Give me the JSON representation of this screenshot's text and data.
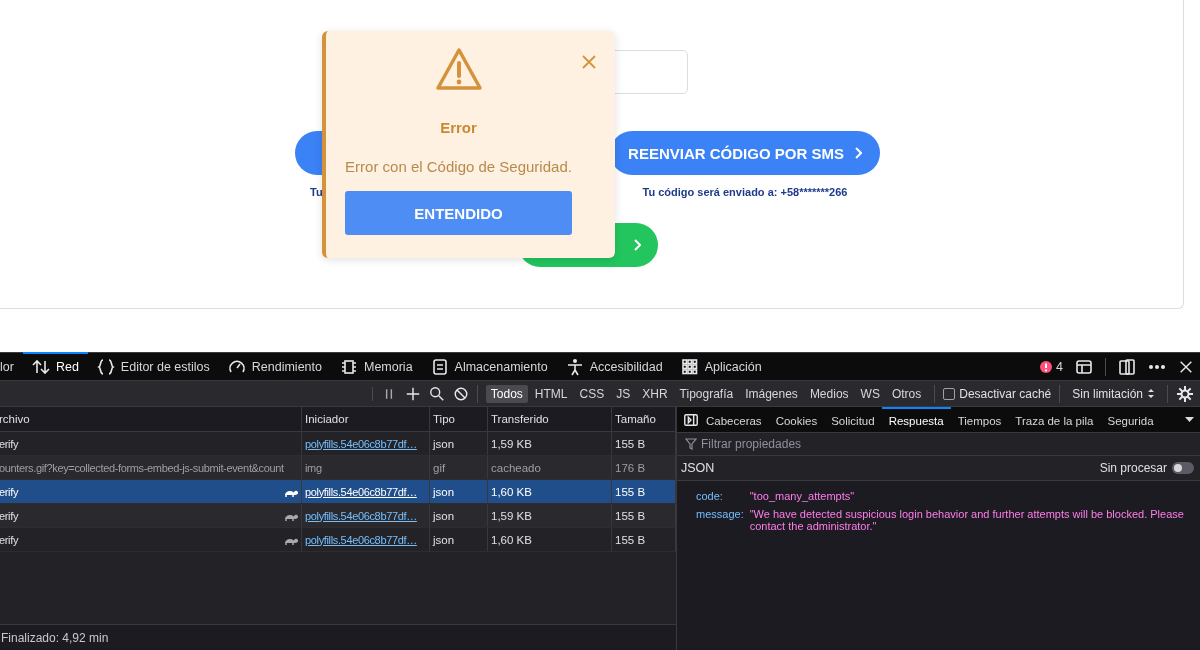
{
  "page": {
    "resend_options": [
      {
        "caption": "Tu"
      },
      {
        "label": "REENVIAR CÓDIGO POR SMS",
        "caption": "Tu código será enviado a: +58*******266"
      }
    ]
  },
  "error_dialog": {
    "title": "Error",
    "message": "Error con el Código de Seguridad.",
    "button": "ENTENDIDO"
  },
  "devtools": {
    "tabs": [
      {
        "label": "lor",
        "selected": false
      },
      {
        "label": "Red",
        "selected": true
      },
      {
        "label": "Editor de estilos",
        "selected": false
      },
      {
        "label": "Rendimiento",
        "selected": false
      },
      {
        "label": "Memoria",
        "selected": false
      },
      {
        "label": "Almacenamiento",
        "selected": false
      },
      {
        "label": "Accesibilidad",
        "selected": false
      },
      {
        "label": "Aplicación",
        "selected": false
      }
    ],
    "error_count": "4",
    "filters": [
      {
        "label": "Todos",
        "selected": true
      },
      {
        "label": "HTML",
        "selected": false
      },
      {
        "label": "CSS",
        "selected": false
      },
      {
        "label": "JS",
        "selected": false
      },
      {
        "label": "XHR",
        "selected": false
      },
      {
        "label": "Tipografía",
        "selected": false
      },
      {
        "label": "Imágenes",
        "selected": false
      },
      {
        "label": "Medios",
        "selected": false
      },
      {
        "label": "WS",
        "selected": false
      },
      {
        "label": "Otros",
        "selected": false
      }
    ],
    "disable_cache": {
      "label": "Desactivar caché",
      "checked": false
    },
    "throttling": "Sin limitación",
    "requests": {
      "columns": [
        "rchivo",
        "Iniciador",
        "Tipo",
        "Transferido",
        "Tamaño"
      ],
      "rows": [
        {
          "file": "erify",
          "initiator": "polyfills.54e06c8b77df…",
          "type": "json",
          "transferred": "1,59 KB",
          "size": "155 B",
          "selected": false,
          "slow": false,
          "cached": false
        },
        {
          "file": "ounters.gif?key=collected-forms-embed-js-submit-event&count",
          "initiator": "img",
          "type": "gif",
          "transferred": "cacheado",
          "size": "176 B",
          "selected": false,
          "slow": false,
          "cached": true
        },
        {
          "file": "erify",
          "initiator": "polyfills.54e06c8b77df…",
          "type": "json",
          "transferred": "1,60 KB",
          "size": "155 B",
          "selected": true,
          "slow": true,
          "cached": false
        },
        {
          "file": "erify",
          "initiator": "polyfills.54e06c8b77df…",
          "type": "json",
          "transferred": "1,59 KB",
          "size": "155 B",
          "selected": false,
          "slow": true,
          "cached": false
        },
        {
          "file": "erify",
          "initiator": "polyfills.54e06c8b77df…",
          "type": "json",
          "transferred": "1,60 KB",
          "size": "155 B",
          "selected": false,
          "slow": true,
          "cached": false
        }
      ]
    },
    "status": "Finalizado: 4,92 min",
    "details": {
      "tabs": [
        {
          "label": "Cabeceras",
          "selected": false
        },
        {
          "label": "Cookies",
          "selected": false
        },
        {
          "label": "Solicitud",
          "selected": false
        },
        {
          "label": "Respuesta",
          "selected": true
        },
        {
          "label": "Tiempos",
          "selected": false
        },
        {
          "label": "Traza de la pila",
          "selected": false
        },
        {
          "label": "Segurida",
          "selected": false
        }
      ],
      "filter_placeholder": "Filtrar propiedades",
      "view_label": "JSON",
      "raw_toggle": {
        "label": "Sin procesar",
        "on": false
      },
      "properties": [
        {
          "key": "code:",
          "value": "\"too_many_attempts\""
        },
        {
          "key": "message:",
          "value": "\"We have detected suspicious login behavior and further attempts will be blocked. Please contact the administrator.\""
        }
      ]
    }
  }
}
